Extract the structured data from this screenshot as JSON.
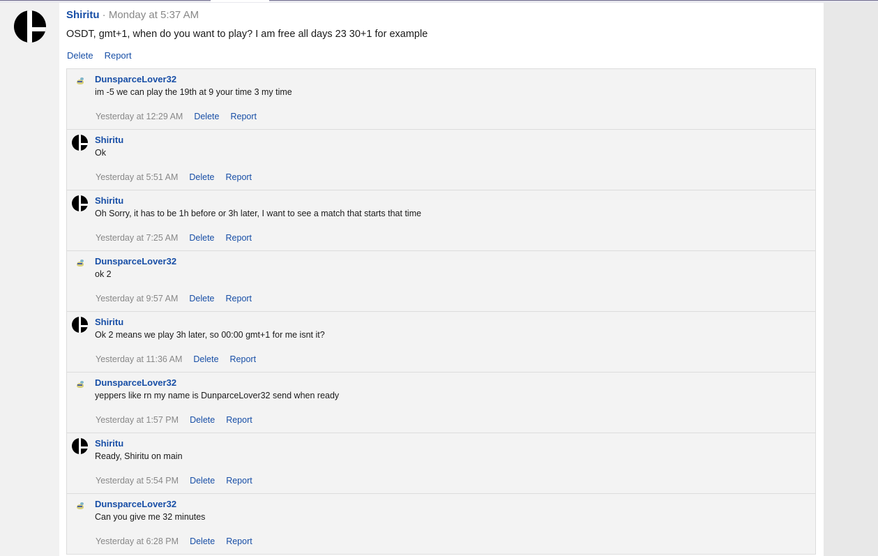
{
  "post": {
    "author": "Shiritu",
    "separator": " · ",
    "time": "Monday at 5:37 AM",
    "body": "OSDT, gmt+1, when do you want to play? I am free all days 23 30+1 for example",
    "actions": {
      "delete": "Delete",
      "report": "Report"
    }
  },
  "comments": [
    {
      "author": "DunsparceLover32",
      "avatar": "dunsparce",
      "text": "im -5 we can play the 19th at 9 your time 3 my time",
      "time": "Yesterday at 12:29 AM",
      "delete": "Delete",
      "report": "Report"
    },
    {
      "author": "Shiritu",
      "avatar": "smash",
      "text": "Ok",
      "time": "Yesterday at 5:51 AM",
      "delete": "Delete",
      "report": "Report"
    },
    {
      "author": "Shiritu",
      "avatar": "smash",
      "text": "Oh Sorry, it has to be 1h before or 3h later, I want to see a match that starts that time",
      "time": "Yesterday at 7:25 AM",
      "delete": "Delete",
      "report": "Report"
    },
    {
      "author": "DunsparceLover32",
      "avatar": "dunsparce",
      "text": "ok 2",
      "time": "Yesterday at 9:57 AM",
      "delete": "Delete",
      "report": "Report"
    },
    {
      "author": "Shiritu",
      "avatar": "smash",
      "text": "Ok 2 means we play 3h later, so 00:00 gmt+1 for me isnt it?",
      "time": "Yesterday at 11:36 AM",
      "delete": "Delete",
      "report": "Report"
    },
    {
      "author": "DunsparceLover32",
      "avatar": "dunsparce",
      "text": "yeppers like rn my name is DunparceLover32 send when ready",
      "time": "Yesterday at 1:57 PM",
      "delete": "Delete",
      "report": "Report"
    },
    {
      "author": "Shiritu",
      "avatar": "smash",
      "text": "Ready, Shiritu on main",
      "time": "Yesterday at 5:54 PM",
      "delete": "Delete",
      "report": "Report"
    },
    {
      "author": "DunsparceLover32",
      "avatar": "dunsparce",
      "text": "Can you give me 32 minutes",
      "time": "Yesterday at 6:28 PM",
      "delete": "Delete",
      "report": "Report"
    }
  ],
  "colors": {
    "link": "#174ea6",
    "meta": "#888888",
    "comment_bg": "#f3f3f3"
  }
}
